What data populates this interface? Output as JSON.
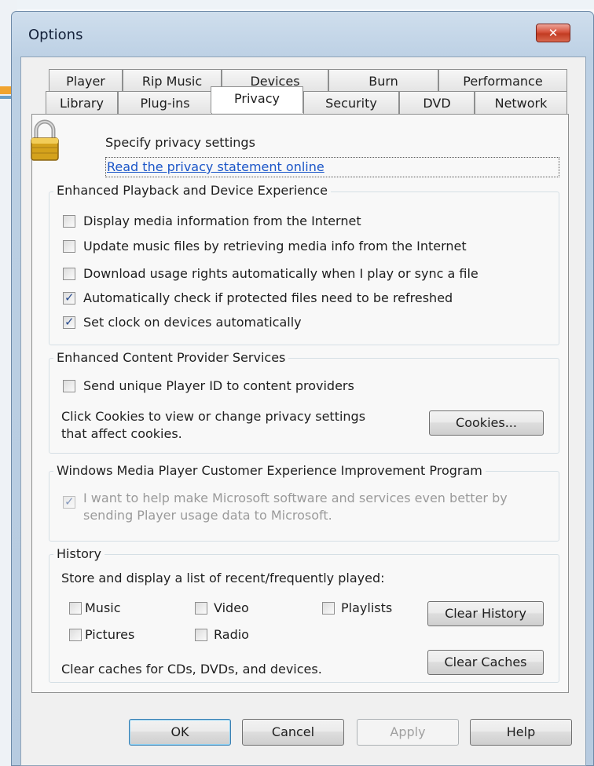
{
  "window": {
    "title": "Options",
    "close_glyph": "✕"
  },
  "tabs": {
    "row_back": [
      "Player",
      "Rip Music",
      "Devices",
      "Burn",
      "Performance"
    ],
    "row_front": [
      "Library",
      "Plug-ins",
      "Privacy",
      "Security",
      "DVD",
      "Network"
    ],
    "active": "Privacy"
  },
  "header": {
    "icon": "padlock-icon",
    "heading": "Specify privacy settings",
    "link": "Read the privacy statement online"
  },
  "playback_group": {
    "title": "Enhanced Playback and Device Experience",
    "options": [
      {
        "label": "Display media information from the Internet",
        "checked": false
      },
      {
        "label": "Update music files by retrieving media info from the Internet",
        "checked": false
      },
      {
        "label": "Download usage rights automatically when I play or sync a file",
        "checked": false
      },
      {
        "label": "Automatically check if protected files need to be refreshed",
        "checked": true
      },
      {
        "label": "Set clock on devices automatically",
        "checked": true
      }
    ]
  },
  "content_group": {
    "title": "Enhanced Content Provider Services",
    "option": {
      "label": "Send unique Player ID to content providers",
      "checked": false
    },
    "cookies_text_line1": "Click Cookies to view or change privacy settings",
    "cookies_text_line2": "that affect cookies.",
    "cookies_button": "Cookies..."
  },
  "ceip_group": {
    "title": "Windows Media Player Customer Experience Improvement Program",
    "option_line1": "I want to help make Microsoft software and services even better by",
    "option_line2": "sending Player usage data to Microsoft.",
    "checked": true,
    "disabled": true
  },
  "history_group": {
    "title": "History",
    "description": "Store and display a list of recent/frequently played:",
    "items": [
      {
        "label": "Music",
        "checked": false
      },
      {
        "label": "Video",
        "checked": false
      },
      {
        "label": "Playlists",
        "checked": false
      },
      {
        "label": "Pictures",
        "checked": false
      },
      {
        "label": "Radio",
        "checked": false
      }
    ],
    "clear_history_button": "Clear History",
    "caches_text": "Clear caches for CDs, DVDs, and devices.",
    "clear_caches_button": "Clear Caches"
  },
  "footer": {
    "ok": "OK",
    "cancel": "Cancel",
    "apply": "Apply",
    "help": "Help"
  },
  "colors": {
    "link": "#1a55c8",
    "close_button": "#c23b22",
    "check_mark": "#2a4d8f"
  }
}
